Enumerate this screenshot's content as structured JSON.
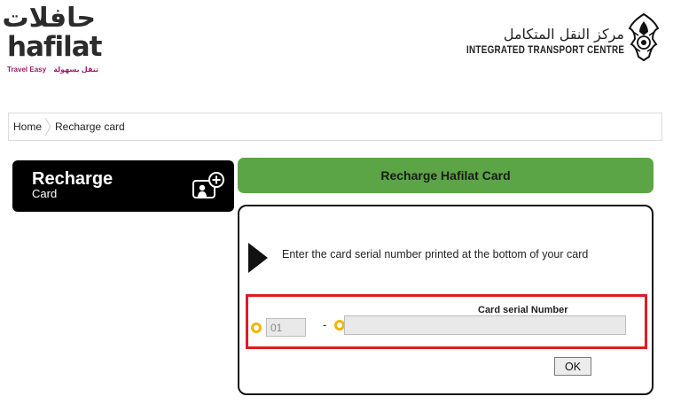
{
  "brand": {
    "arabic_logo": "حافلات",
    "name": "hafilat",
    "tagline_en": "Travel Easy",
    "tagline_ar": "تنقل بسهولة"
  },
  "agency": {
    "arabic_name": "مركز النقل المتكامل",
    "english_name": "INTEGRATED TRANSPORT CENTRE",
    "emblem_icon": "abu-dhabi-falcon-emblem-icon"
  },
  "breadcrumb": {
    "items": [
      {
        "label": "Home"
      },
      {
        "label": "Recharge card"
      }
    ],
    "separator_icon": "chevron-right-icon"
  },
  "side_menu": {
    "title": "Recharge",
    "subtitle": "Card",
    "icon": "card-add-icon"
  },
  "form": {
    "heading": "Recharge Hafilat Card",
    "instruction": "Enter the card serial number printed at the bottom of your card",
    "serial_label": "Card serial Number",
    "prefix_value": "01",
    "separator": "-",
    "serial_value": "",
    "ok_label": "OK"
  },
  "colors": {
    "heading_bar": "#5ca546",
    "highlight_border": "#e01b22",
    "bullet": "#f2b500",
    "brand_accent": "#9b1b6a"
  }
}
